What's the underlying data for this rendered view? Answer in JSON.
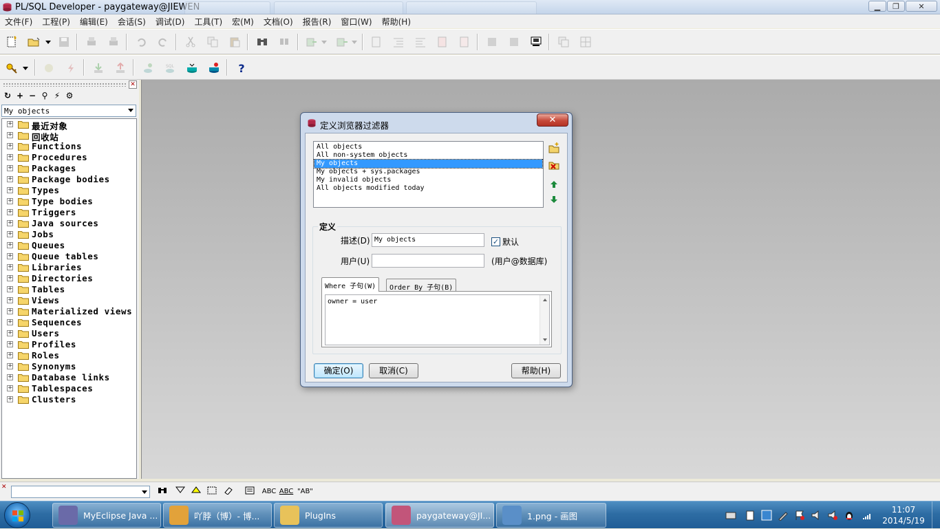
{
  "window": {
    "title": "PL/SQL Developer - paygateway@JIEWEN",
    "min_glyph": "▁",
    "max_glyph": "❐",
    "close_glyph": "✕"
  },
  "menu": [
    "文件(F)",
    "工程(P)",
    "编辑(E)",
    "会话(S)",
    "调试(D)",
    "工具(T)",
    "宏(M)",
    "文档(O)",
    "报告(R)",
    "窗口(W)",
    "帮助(H)"
  ],
  "toolbar2": {
    "help_glyph": "?"
  },
  "browser": {
    "panel_close_glyph": "✕",
    "icons": [
      "↻",
      "+",
      "−",
      "⚲",
      "⚡",
      "⚙"
    ],
    "filter_value": "My objects",
    "expand_glyph": "+",
    "items": [
      "最近对象",
      "回收站",
      "Functions",
      "Procedures",
      "Packages",
      "Package bodies",
      "Types",
      "Type bodies",
      "Triggers",
      "Java sources",
      "Jobs",
      "Queues",
      "Queue tables",
      "Libraries",
      "Directories",
      "Tables",
      "Views",
      "Materialized views",
      "Sequences",
      "Users",
      "Profiles",
      "Roles",
      "Synonyms",
      "Database links",
      "Tablespaces",
      "Clusters"
    ]
  },
  "dialog": {
    "title": "定义浏览器过滤器",
    "close_glyph": "✕",
    "filters": [
      "All objects",
      "All non-system objects",
      "My objects",
      "My objects + sys.packages",
      "My invalid objects",
      "All objects modified today"
    ],
    "selected_filter": "My objects",
    "definition_label": "定义",
    "description_label": "描述(D)",
    "description_value": "My objects",
    "default_label": "默认",
    "default_checked": true,
    "check_glyph": "✓",
    "user_label": "用户(U)",
    "user_value": "",
    "user_hint": "(用户@数据库)",
    "tab_where": "Where 子句(W)",
    "tab_orderby": "Order By 子句(B)",
    "where_value": "owner = user",
    "ok_label": "确定(O)",
    "cancel_label": "取消(C)",
    "help_label": "帮助(H)"
  },
  "findbar": {
    "close_glyph": "✕",
    "search_value": "",
    "tool_labels": [
      "ABC",
      "ABC",
      "\"AB\""
    ]
  },
  "taskbar": {
    "tasks": [
      {
        "label": "MyEclipse Java ...",
        "color": "#6a6aa8"
      },
      {
        "label": "吖脖（博）- 博...",
        "color": "#e2a23a"
      },
      {
        "label": "PlugIns",
        "color": "#e8c25a"
      },
      {
        "label": "paygateway@JI...",
        "color": "#c2557a"
      },
      {
        "label": "1.png - 画图",
        "color": "#5a8fc8"
      }
    ],
    "time": "11:07",
    "date": "2014/5/19"
  }
}
